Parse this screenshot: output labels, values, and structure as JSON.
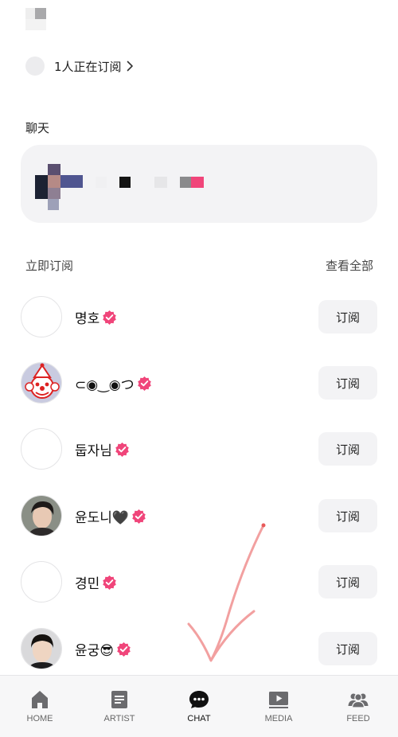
{
  "watching": {
    "text": "1人正在订阅"
  },
  "chat_section": {
    "title": "聊天"
  },
  "subscribe_section": {
    "title": "立即订阅",
    "view_all": "查看全部"
  },
  "artists": [
    {
      "name": "명호",
      "button": "订阅",
      "avatar": "blank"
    },
    {
      "name": "⊂◉‿◉つ",
      "button": "订阅",
      "avatar": "clown"
    },
    {
      "name": "둡자님",
      "button": "订阅",
      "avatar": "blank"
    },
    {
      "name": "윤도니🖤",
      "button": "订阅",
      "avatar": "photo"
    },
    {
      "name": "경민",
      "button": "订阅",
      "avatar": "blank"
    },
    {
      "name": "윤궁😎",
      "button": "订阅",
      "avatar": "photo"
    }
  ],
  "nav": [
    {
      "label": "HOME",
      "icon": "home-icon"
    },
    {
      "label": "ARTIST",
      "icon": "document-icon"
    },
    {
      "label": "CHAT",
      "icon": "chat-bubble-icon",
      "active": true
    },
    {
      "label": "MEDIA",
      "icon": "play-icon"
    },
    {
      "label": "FEED",
      "icon": "people-icon"
    }
  ],
  "colors": {
    "verified": "#f0457a",
    "doodle": "#f2a0a0",
    "card": "#f3f3f5",
    "nav_bg": "#f7f7f8"
  }
}
